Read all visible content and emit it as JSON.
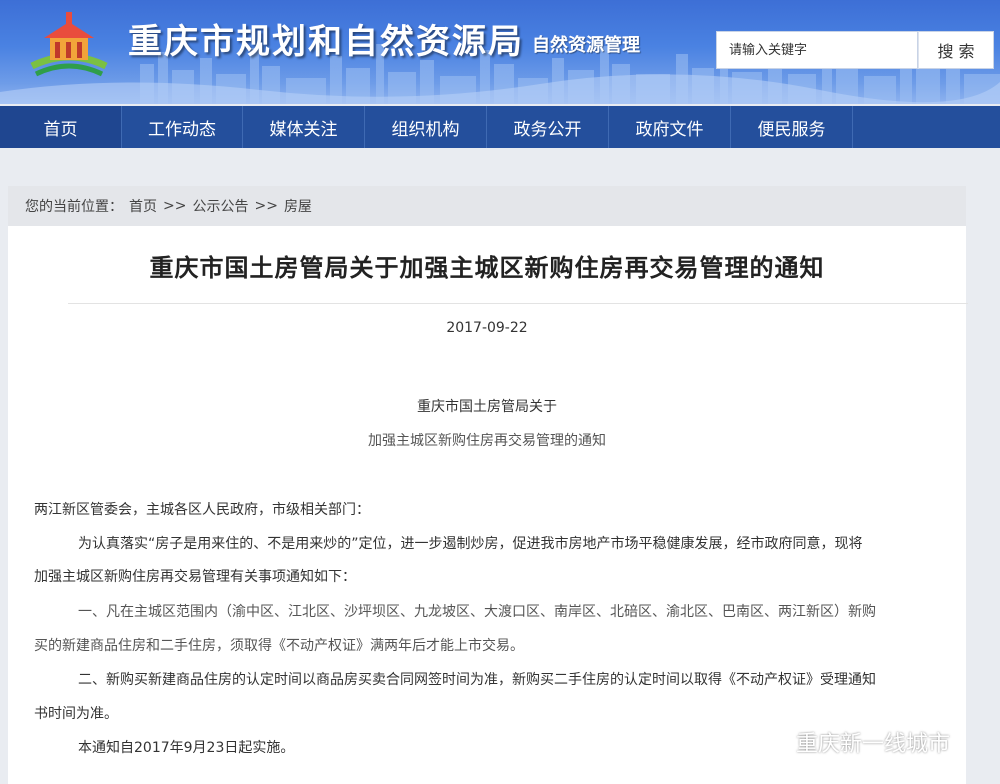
{
  "header": {
    "site_title": "重庆市规划和自然资源局",
    "site_subtitle": "自然资源管理",
    "search_placeholder": "请输入关键字",
    "search_button": "搜 索"
  },
  "nav": {
    "items": [
      {
        "label": "首页",
        "active": true
      },
      {
        "label": "工作动态"
      },
      {
        "label": "媒体关注"
      },
      {
        "label": "组织机构"
      },
      {
        "label": "政务公开"
      },
      {
        "label": "政府文件"
      },
      {
        "label": "便民服务"
      }
    ]
  },
  "breadcrumb": {
    "prefix": "您的当前位置：",
    "items": [
      "首页",
      "公示公告",
      "房屋"
    ],
    "separator": ">>"
  },
  "article": {
    "title": "重庆市国土房管局关于加强主城区新购住房再交易管理的通知",
    "date": "2017-09-22",
    "doc_heading_1": "重庆市国土房管局关于",
    "doc_heading_2": "加强主城区新购住房再交易管理的通知",
    "addressee": "两江新区管委会，主城各区人民政府，市级相关部门：",
    "para1_line1": "为认真落实“房子是用来住的、不是用来炒的”定位，进一步遏制炒房，促进我市房地产市场平稳健康发展，经市政府同意，现将",
    "para1_line2": "加强主城区新购住房再交易管理有关事项通知如下：",
    "item1_line1": "一、凡在主城区范围内（渝中区、江北区、沙坪坝区、九龙坡区、大渡口区、南岸区、北碚区、渝北区、巴南区、两江新区）新购",
    "item1_line2": "买的新建商品住房和二手住房，须取得《不动产权证》满两年后才能上市交易。",
    "item2_line1": "二、新购买新建商品住房的认定时间以商品房买卖合同网签时间为准，新购买二手住房的认定时间以取得《不动产权证》受理通知",
    "item2_line2": "书时间为准。",
    "effective": "本通知自2017年9月23日起实施。"
  },
  "watermark": {
    "text": "重庆新一线城市"
  },
  "colors": {
    "banner": "#4a82e2",
    "nav": "#244f9c",
    "breadcrumb_bg": "#e4e6ea"
  }
}
